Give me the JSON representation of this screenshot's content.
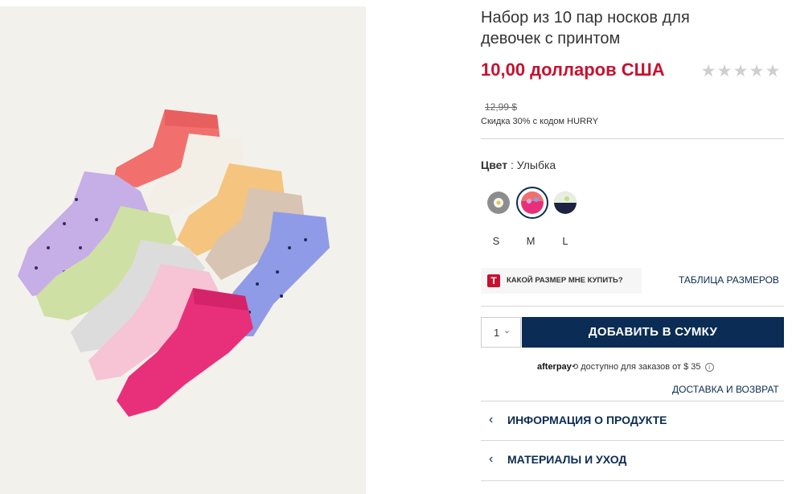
{
  "product": {
    "title": "Набор из 10 пар носков для девочек с принтом",
    "price": "10,00 долларов США",
    "old_price": "12,99 $",
    "discount_note": "Скидка 30% с кодом HURRY",
    "rating": {
      "stars_shown": 5,
      "filled": 0,
      "glyph": "★"
    }
  },
  "color": {
    "label": "Цвет",
    "separator": " : ",
    "selected": "Улыбка",
    "swatches": [
      {
        "name": "swatch-daisy",
        "selected": false
      },
      {
        "name": "swatch-smile",
        "selected": true
      },
      {
        "name": "swatch-dark-print",
        "selected": false
      }
    ]
  },
  "sizes": [
    "S",
    "M",
    "L"
  ],
  "size_help": {
    "icon_letter": "T",
    "label": "КАКОЙ РАЗМЕР МНЕ КУПИТЬ?"
  },
  "size_chart_link": "ТАБЛИЦА РАЗМЕРОВ",
  "quantity": {
    "value": "1",
    "chevron": "⌄"
  },
  "add_to_bag": "ДОБАВИТЬ В СУМКУ",
  "afterpay": {
    "brand": "afterpay",
    "logo_glyph": "⟲",
    "text": " доступно для заказов от $ 35 ",
    "info_glyph": "i"
  },
  "shipping_link": "ДОСТАВКА И ВОЗВРАТ",
  "accordion": [
    {
      "chevron": "‹",
      "label": "ИНФОРМАЦИЯ О ПРОДУКТЕ"
    },
    {
      "chevron": "‹",
      "label": "МАТЕРИАЛЫ И УХОД"
    }
  ],
  "colors": {
    "price_red": "#c8102e",
    "navy": "#0b2c54",
    "divider": "#d6d6d6",
    "image_bg": "#f3f1ec"
  }
}
